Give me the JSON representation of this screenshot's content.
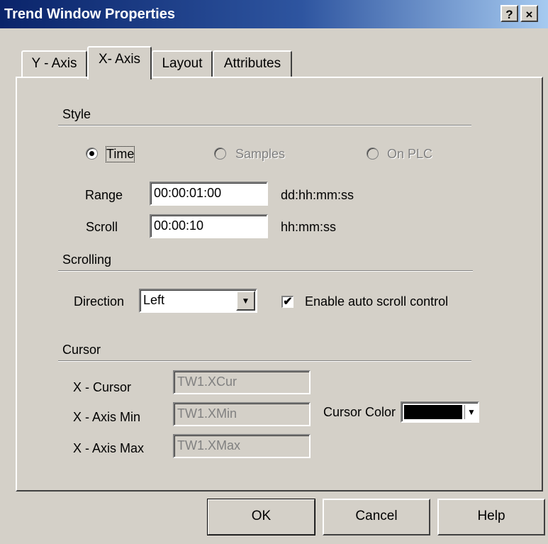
{
  "window": {
    "title": "Trend Window Properties",
    "help_label": "?",
    "close_label": "×"
  },
  "tabs": [
    {
      "label": "Y - Axis"
    },
    {
      "label": "X- Axis",
      "active": true
    },
    {
      "label": "Layout"
    },
    {
      "label": "Attributes"
    }
  ],
  "style": {
    "label": "Style",
    "options": [
      {
        "label": "Time",
        "selected": true,
        "enabled": true
      },
      {
        "label": "Samples",
        "selected": false,
        "enabled": false
      },
      {
        "label": "On PLC",
        "selected": false,
        "enabled": false
      }
    ],
    "range": {
      "label": "Range",
      "value": "00:00:01:00",
      "unit": "dd:hh:mm:ss"
    },
    "scroll": {
      "label": "Scroll",
      "value": "00:00:10",
      "unit": "hh:mm:ss"
    }
  },
  "scrolling": {
    "label": "Scrolling",
    "direction_label": "Direction",
    "direction_value": "Left",
    "auto_scroll_label": "Enable auto scroll control",
    "auto_scroll_checked": true,
    "check_mark": "✔"
  },
  "cursor": {
    "label": "Cursor",
    "x_cursor": {
      "label": "X - Cursor",
      "value": "TW1.XCur"
    },
    "x_axis_min": {
      "label": "X - Axis Min",
      "value": "TW1.XMin"
    },
    "x_axis_max": {
      "label": "X - Axis Max",
      "value": "TW1.XMax"
    },
    "color_label": "Cursor Color",
    "color_value": "#000000"
  },
  "buttons": {
    "ok": "OK",
    "cancel": "Cancel",
    "help": "Help"
  },
  "icons": {
    "dropdown_arrow": "▼"
  }
}
